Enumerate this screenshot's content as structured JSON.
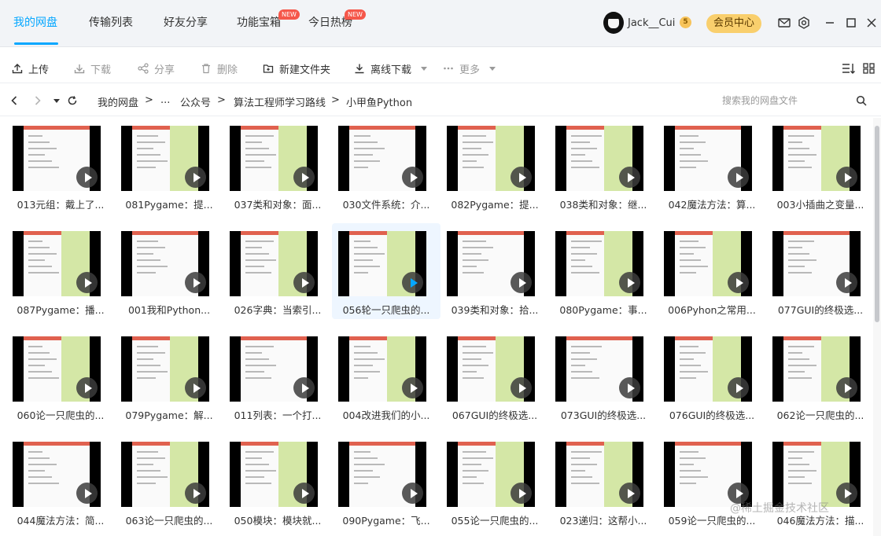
{
  "nav": {
    "tabs": [
      "我的网盘",
      "传输列表",
      "好友分享",
      "功能宝箱",
      "今日热榜"
    ],
    "new_badge": "NEW"
  },
  "user": {
    "name": "Jack__Cui",
    "level": "5",
    "vip_label": "会员中心"
  },
  "toolbar": {
    "upload": "上传",
    "download": "下载",
    "share": "分享",
    "delete": "删除",
    "new_folder": "新建文件夹",
    "offline_download": "离线下载",
    "more": "更多"
  },
  "path": {
    "crumbs": [
      "我的网盘",
      "...",
      "公众号",
      "算法工程师学习路线",
      "小甲鱼Python"
    ],
    "separator": ">"
  },
  "search": {
    "placeholder": "搜索我的网盘文件"
  },
  "files": [
    "013元组：戴上了...",
    "081Pygame：提...",
    "037类和对象：面...",
    "030文件系统：介...",
    "082Pygame：提...",
    "038类和对象：继...",
    "042魔法方法：算...",
    "003小插曲之变量...",
    "087Pygame：播...",
    "001我和Python...",
    "026字典：当索引...",
    "056轮一只爬虫的...",
    "039类和对象：拾...",
    "080Pygame：事...",
    "006Pyhon之常用...",
    "077GUI的终极选...",
    "060论一只爬虫的...",
    "079Pygame：解...",
    "011列表：一个打...",
    "004改进我们的小...",
    "067GUI的终极选...",
    "073GUI的终极选...",
    "076GUI的终极选...",
    "062论一只爬虫的...",
    "044魔法方法：简...",
    "063论一只爬虫的...",
    "050模块：模块就...",
    "090Pygame：飞...",
    "055论一只爬虫的...",
    "023递归：这帮小...",
    "059论一只爬虫的...",
    "046魔法方法：描..."
  ],
  "watermark": "@稀土掘金技术社区",
  "colors": {
    "accent": "#06a7ff",
    "vip": "#f9cf6d",
    "badge": "#f5574a"
  }
}
